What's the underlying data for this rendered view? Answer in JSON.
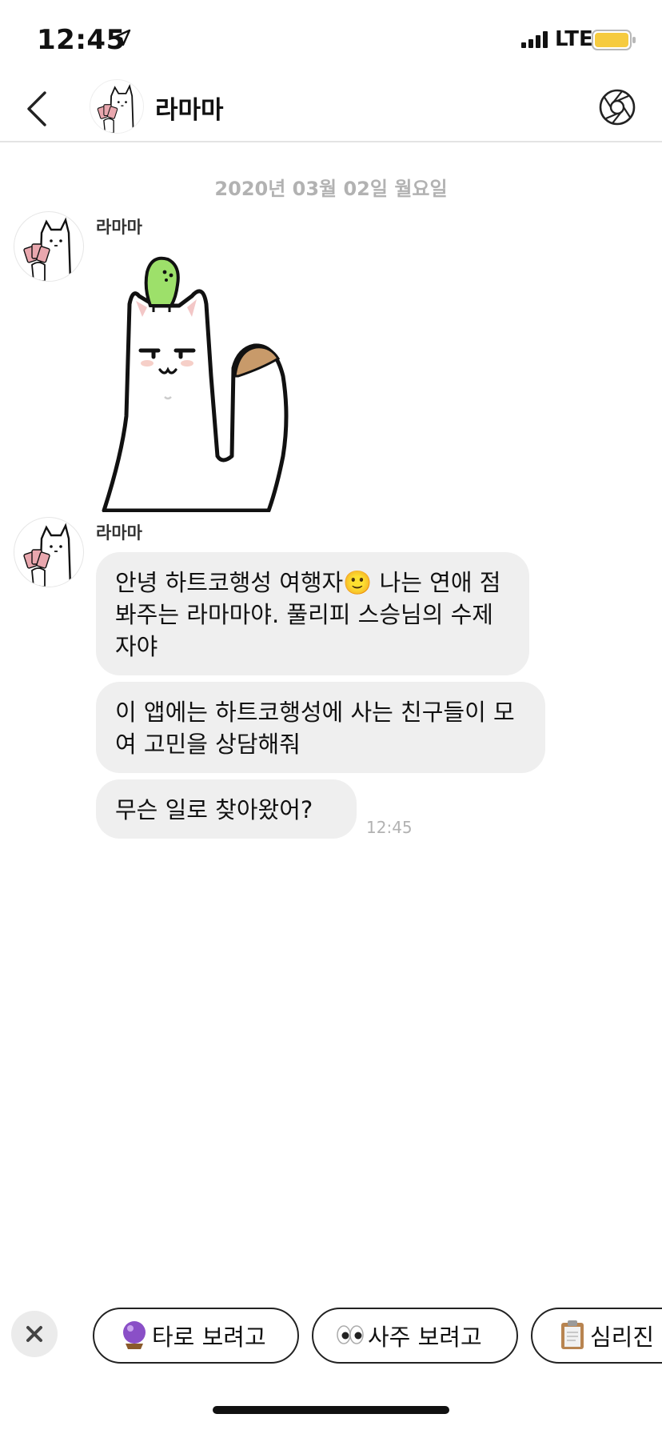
{
  "status_bar": {
    "time": "12:45",
    "network": "LTE",
    "icons": [
      "location-arrow-icon",
      "signal-icon",
      "battery-icon"
    ],
    "battery_color": "#f6cb3f"
  },
  "header": {
    "title": "라마마",
    "icons": [
      "chevron-left-icon",
      "camera-shutter-icon"
    ]
  },
  "chat": {
    "date_divider": "2020년 03월 02일 월요일",
    "groups": [
      {
        "sender": "라마마",
        "content_type": "sticker",
        "sticker_name": "cat-with-leaf-sticker"
      },
      {
        "sender": "라마마",
        "messages": [
          {
            "text": "안녕 하트코행성 여행자🙂 나는 연애 점 봐주는 라마마야. 풀리피 스승님의 수제자야"
          },
          {
            "text": "이 앱에는 하트코행성에 사는 친구들이 모여 고민을 상담해줘"
          },
          {
            "text": "무슨 일로 찾아왔어?"
          }
        ],
        "time": "12:45"
      }
    ]
  },
  "quick_replies": {
    "close_icon": "close-icon",
    "chips": [
      {
        "icon": "crystal-ball-icon",
        "label": "타로 보려고"
      },
      {
        "icon": "eyes-icon",
        "label": "사주 보려고"
      },
      {
        "icon": "clipboard-icon",
        "label": "심리진"
      }
    ]
  },
  "colors": {
    "bubble_bg": "#efefef",
    "muted_text": "#b2b2b2",
    "highlight_border": "#e02020"
  }
}
